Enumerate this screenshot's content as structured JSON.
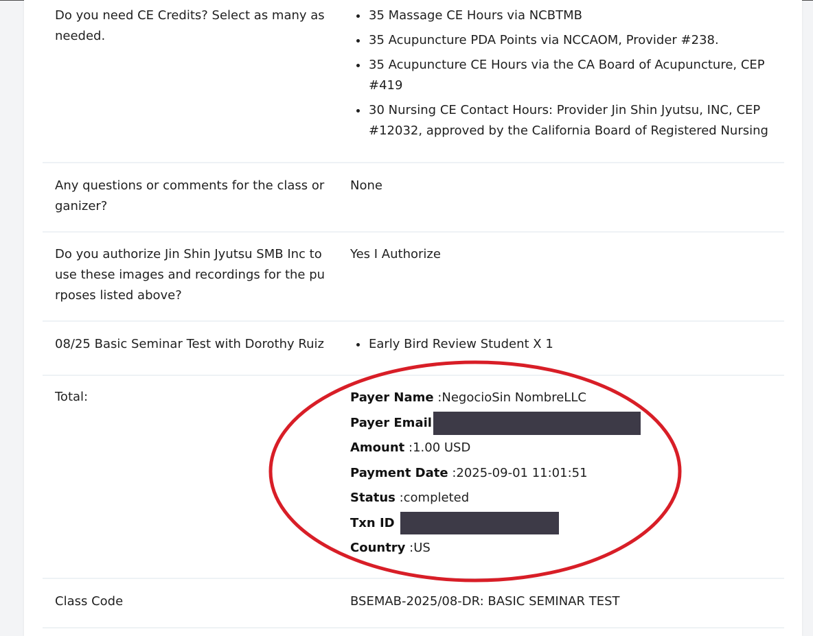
{
  "rows": {
    "ce_credits": {
      "label": "Do you need CE Credits? Select as many as needed.",
      "items": [
        "35 Massage CE Hours via NCBTMB",
        "35 Acupuncture PDA Points via NCCAOM, Provider #238.",
        "35 Acupuncture CE Hours via the CA Board of Acupuncture, CEP #419",
        "30 Nursing CE Contact Hours: Provider Jin Shin Jyutsu, INC, CEP #12032, approved by the California Board of Registered Nursing"
      ]
    },
    "questions": {
      "label_line1": "Any questions or comments for the class or",
      "label_line2": "ganizer?",
      "value": "None"
    },
    "authorize": {
      "label_line1": "Do you authorize Jin Shin Jyutsu SMB Inc to",
      "label_line2": "use these images and recordings for the pu",
      "label_line3": "rposes listed above?",
      "value": "Yes I Authorize"
    },
    "seminar": {
      "label": "08/25 Basic Seminar Test with Dorothy Ruiz",
      "items": [
        "Early Bird Review Student X 1"
      ]
    },
    "total": {
      "label": "Total:",
      "payer_name_key": "Payer Name",
      "payer_name_value": " :NegocioSin NombreLLC",
      "payer_email_key": "Payer Email",
      "amount_key": "Amount",
      "amount_value": " :1.00 USD",
      "payment_date_key": "Payment Date",
      "payment_date_value": " :2025-09-01 11:01:51",
      "status_key": "Status",
      "status_value": " :completed",
      "txn_id_key": "Txn ID",
      "country_key": "Country",
      "country_value": " :US"
    },
    "class_code": {
      "label": "Class Code",
      "value": "BSEMAB-2025/08-DR: BASIC SEMINAR TEST"
    }
  },
  "colors": {
    "highlight_ellipse": "#d81e27",
    "redaction": "#3d3a47",
    "row_divider": "#eef2f5"
  }
}
